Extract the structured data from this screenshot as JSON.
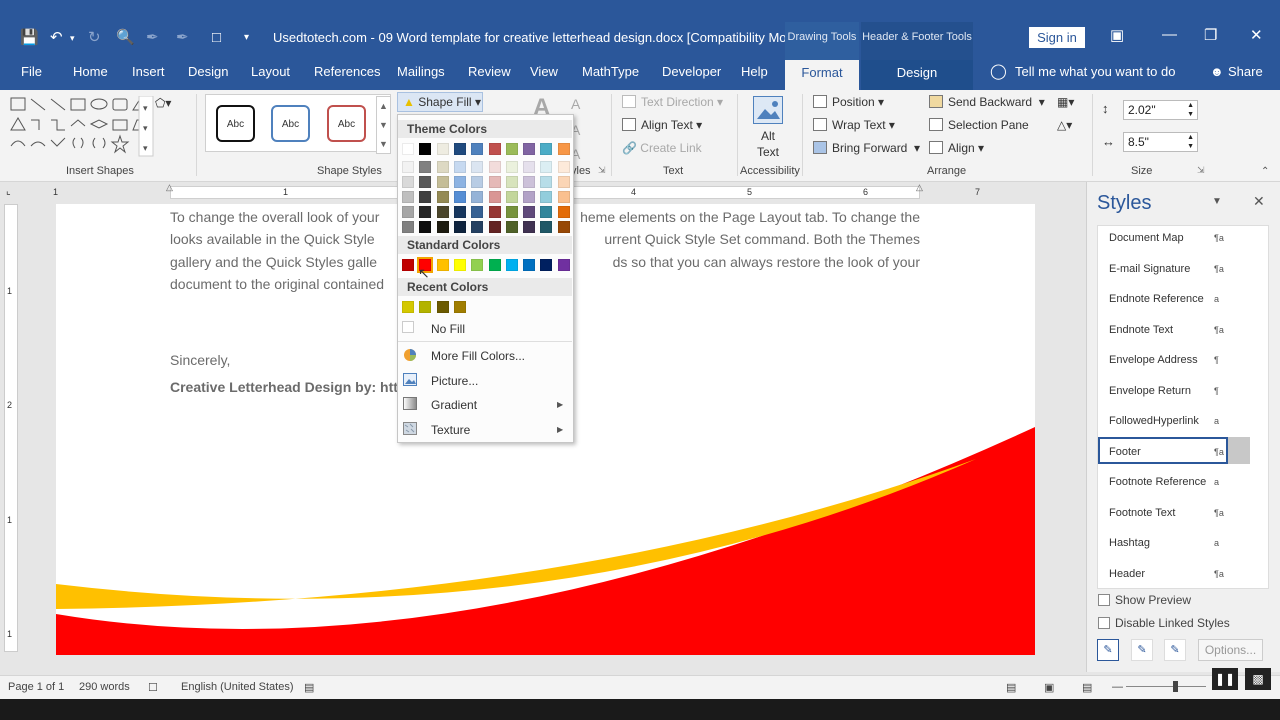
{
  "window": {
    "title": "Usedtotech.com - 09 Word template for creative letterhead design.docx [Compatibility Mod...",
    "context_tabs": [
      "Drawing Tools",
      "Header & Footer Tools"
    ],
    "sign_in": "Sign in",
    "share": "Share",
    "tell_me": "Tell me what you want to do"
  },
  "tabs": [
    "File",
    "Home",
    "Insert",
    "Design",
    "Layout",
    "References",
    "Mailings",
    "Review",
    "View",
    "MathType",
    "Developer",
    "Help"
  ],
  "context_tab_format": "Format",
  "context_tab_design": "Design",
  "ribbon": {
    "groups": {
      "insert_shapes": "Insert Shapes",
      "shape_styles": "Shape Styles",
      "wordart_partial": "yles",
      "text": "Text",
      "accessibility": "Accessibility",
      "arrange": "Arrange",
      "size": "Size"
    },
    "abc": [
      "Abc",
      "Abc",
      "Abc"
    ],
    "shape_fill": "Shape Fill",
    "text_direction": "Text Direction",
    "align_text": "Align Text",
    "create_link": "Create Link",
    "alt_text_1": "Alt",
    "alt_text_2": "Text",
    "position": "Position",
    "wrap_text": "Wrap Text",
    "bring_forward": "Bring Forward",
    "send_backward": "Send Backward",
    "selection_pane": "Selection Pane",
    "align": "Align",
    "height": "2.02\"",
    "width": "8.5\""
  },
  "ruler_numbers": [
    "1",
    "1",
    "2",
    "3",
    "4",
    "5",
    "6",
    "7"
  ],
  "vruler_numbers": [
    "1",
    "2",
    "1",
    "1"
  ],
  "document": {
    "para1_line1": "To change the overall look of your",
    "para1_line1b": "heme elements on the Page Layout tab. To change the",
    "para1_line2": "looks available in the Quick Style",
    "para1_line2b": "urrent Quick Style Set command. Both the Themes",
    "para1_line3": "gallery and the Quick Styles galle",
    "para1_line3b": "ds so that you can always restore the look of your",
    "para1_line4": "document to the original contained",
    "sincerely": "Sincerely,",
    "signature": "Creative Letterhead Design by: htt"
  },
  "shape_fill_menu": {
    "theme_colors_label": "Theme Colors",
    "standard_colors_label": "Standard Colors",
    "recent_colors_label": "Recent Colors",
    "theme_top_row": [
      "#ffffff",
      "#000000",
      "#eeece1",
      "#1f497d",
      "#4f81bd",
      "#c0504d",
      "#9bbb59",
      "#8064a2",
      "#4bacc6",
      "#f79646"
    ],
    "theme_columns": [
      [
        "#f2f2f2",
        "#d9d9d9",
        "#bfbfbf",
        "#a6a6a6",
        "#808080"
      ],
      [
        "#808080",
        "#595959",
        "#404040",
        "#262626",
        "#0d0d0d"
      ],
      [
        "#ddd9c3",
        "#c4bd97",
        "#948a54",
        "#4a452a",
        "#1d1b10"
      ],
      [
        "#c6d9f0",
        "#8db3e2",
        "#548dd4",
        "#17365d",
        "#0f243e"
      ],
      [
        "#dbe5f1",
        "#b8cce4",
        "#95b3d7",
        "#366092",
        "#244061"
      ],
      [
        "#f2dcdb",
        "#e5b9b7",
        "#d99694",
        "#953734",
        "#632423"
      ],
      [
        "#ebf1dd",
        "#d7e3bc",
        "#c3d69b",
        "#76923c",
        "#4f6128"
      ],
      [
        "#e5e0ec",
        "#ccc1d9",
        "#b2a2c7",
        "#5f497a",
        "#3f3151"
      ],
      [
        "#dbeef3",
        "#b7dde8",
        "#92cddc",
        "#31859b",
        "#205867"
      ],
      [
        "#fdeada",
        "#fbd5b5",
        "#fac08f",
        "#e36c09",
        "#974806"
      ]
    ],
    "standard_colors": [
      "#c00000",
      "#ff0000",
      "#ffc000",
      "#ffff00",
      "#92d050",
      "#00b050",
      "#00b0f0",
      "#0070c0",
      "#002060",
      "#7030a0"
    ],
    "recent_colors": [
      "#d4c800",
      "#b3b300",
      "#6b5a00",
      "#a07d00"
    ],
    "no_fill": "No Fill",
    "more_fill_colors": "More Fill Colors...",
    "picture": "Picture...",
    "gradient": "Gradient",
    "texture": "Texture"
  },
  "styles_pane": {
    "title": "Styles",
    "items": [
      {
        "name": "Document Map",
        "mark": "¶a"
      },
      {
        "name": "E-mail Signature",
        "mark": "¶a"
      },
      {
        "name": "Endnote Reference",
        "mark": "a"
      },
      {
        "name": "Endnote Text",
        "mark": "¶a"
      },
      {
        "name": "Envelope Address",
        "mark": "¶"
      },
      {
        "name": "Envelope Return",
        "mark": "¶"
      },
      {
        "name": "FollowedHyperlink",
        "mark": "a"
      },
      {
        "name": "Footer",
        "mark": "¶a"
      },
      {
        "name": "Footnote Reference",
        "mark": "a"
      },
      {
        "name": "Footnote Text",
        "mark": "¶a"
      },
      {
        "name": "Hashtag",
        "mark": "a"
      },
      {
        "name": "Header",
        "mark": "¶a"
      }
    ],
    "selected": "Footer",
    "show_preview": "Show Preview",
    "disable_linked": "Disable Linked Styles",
    "options": "Options..."
  },
  "status": {
    "page": "Page 1 of 1",
    "words": "290 words",
    "language": "English (United States)"
  },
  "colors": {
    "brand": "#2b579a",
    "footer_red": "#ff0000",
    "footer_yellow": "#ffc000"
  }
}
